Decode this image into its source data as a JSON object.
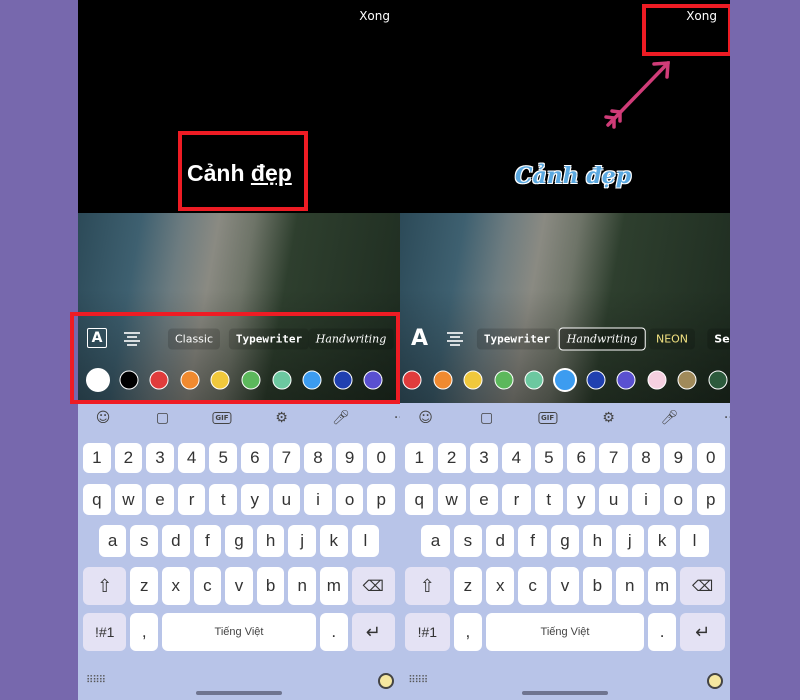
{
  "left": {
    "done_label": "Xong",
    "text_word1": "Cảnh",
    "text_word2": "đẹp",
    "font_styles": [
      "Classic",
      "Typewriter",
      "Handwriting"
    ],
    "colors": [
      "#ffffff",
      "#000000",
      "#e03c3c",
      "#f08a30",
      "#f0c83c",
      "#5cb85c",
      "#6cc8a0",
      "#3c9cf0",
      "#2040b0",
      "#5a50d0"
    ],
    "selected_color": "#ffffff",
    "space_label": "Tiếng Việt"
  },
  "right": {
    "done_label": "Xong",
    "styled_text": "Cảnh đẹp",
    "font_styles": [
      "Typewriter",
      "Handwriting",
      "NEON",
      "Se"
    ],
    "selected_font": "Handwriting",
    "colors": [
      "#e03c3c",
      "#f08a30",
      "#f0c83c",
      "#5cb85c",
      "#6cc8a0",
      "#3c9cf0",
      "#2040b0",
      "#5a50d0",
      "#f5d0e0",
      "#a08a5a",
      "#2c5a3c"
    ],
    "selected_color": "#3c9cf0",
    "space_label": "Tiếng Việt"
  },
  "keyboard": {
    "toolbar_icons": [
      "emoji-icon",
      "sticker-icon",
      "gif-icon",
      "settings-icon",
      "microphone-icon",
      "more-icon"
    ],
    "gif_label": "GIF",
    "rows": [
      [
        "1",
        "2",
        "3",
        "4",
        "5",
        "6",
        "7",
        "8",
        "9",
        "0"
      ],
      [
        "q",
        "w",
        "e",
        "r",
        "t",
        "y",
        "u",
        "i",
        "o",
        "p"
      ],
      [
        "a",
        "s",
        "d",
        "f",
        "g",
        "h",
        "j",
        "k",
        "l"
      ],
      [
        "z",
        "x",
        "c",
        "v",
        "b",
        "n",
        "m"
      ]
    ],
    "symbols_label": "!#1",
    "comma": ",",
    "period": ".",
    "accent_color": "#ee1c24",
    "arrow_color": "#d03c78"
  }
}
